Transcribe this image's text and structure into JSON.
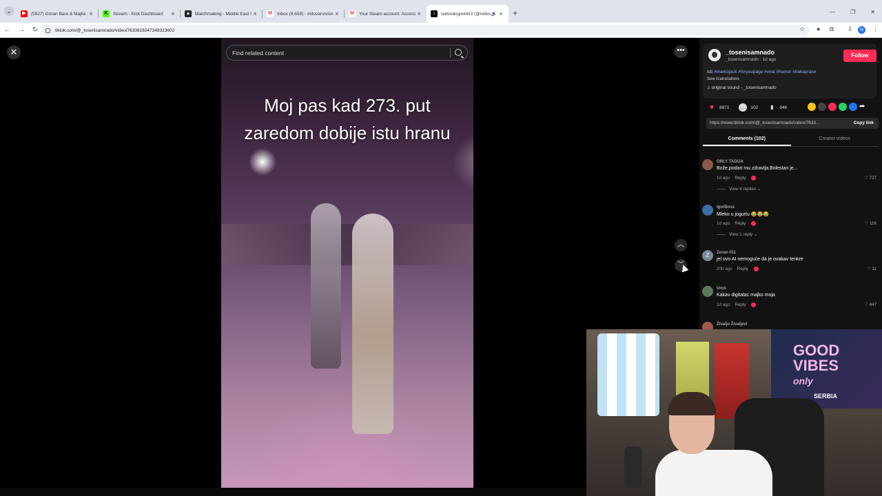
{
  "browser": {
    "tabs": [
      {
        "title": "(5927) Goran Bare & Majke - 3x",
        "favicon_color": "#ff0000",
        "active": false
      },
      {
        "title": "Stream - Kick Dashboard",
        "favicon_color": "#53fc18",
        "active": false
      },
      {
        "title": "Matchmaking - Middle East 5v5",
        "favicon_color": "#222222",
        "active": false
      },
      {
        "title": "Inbox (8,659) - milovanovicnem",
        "favicon_color": "#ea4335",
        "active": false
      },
      {
        "title": "Your Steam account: Access fro",
        "favicon_color": "#ea4335",
        "active": false
      },
      {
        "title": "redovangost4x3 (@redovan",
        "favicon_color": "#000000",
        "active": true
      }
    ],
    "url": "tiktok.com/@_tosenisamnado/video/7633828347348323602",
    "profile_initial": "N"
  },
  "player": {
    "search_placeholder": "Find related content",
    "caption_line1": "Moj pas kad  273. put",
    "caption_line2": "zaredom dobije istu hranu"
  },
  "post": {
    "username": "_tosenisamnado",
    "meta": "_tosenisamnado · 1d ago",
    "follow_label": "Follow",
    "desc_prefix": "Isti ",
    "hashtags": "#markojack #foryoupage #viral #humor #bakaprase",
    "see_translation": "See translation",
    "sound": "original sound - _tosenisamnado",
    "likes": "8871",
    "comments": "102",
    "saves": "946",
    "link": "https://www.tiktok.com/@_tosenisamnado/video/7633...",
    "copy_label": "Copy link"
  },
  "panel_tabs": {
    "comments": "Comments (102)",
    "creator": "Creator videos"
  },
  "comments": [
    {
      "name": "ONLY TADIJA",
      "text": "Bože,podari mu zdravlja.Bolestan je...",
      "time": "1d ago",
      "reply": "Reply",
      "likes": "727",
      "view_replies": "View 4 replies",
      "avatar_color": "#8a5a4a"
    },
    {
      "name": "IgorBoss",
      "text": "Mleko u jogurtu 😂😂😂",
      "time": "1d ago",
      "reply": "Reply",
      "likes": "116",
      "view_replies": "View 1 reply",
      "avatar_color": "#3b6ea5"
    },
    {
      "name": "Zoran 011",
      "text": "jel ovo AI nemoguće da je ovakav tenkre",
      "time": "20h ago",
      "reply": "Reply",
      "likes": "11",
      "avatar_letter": "Z",
      "avatar_color": "#7a8a9a"
    },
    {
      "name": "Uroš",
      "text": "Kakav digitalac majko moja",
      "time": "1d ago",
      "reply": "Reply",
      "likes": "447",
      "avatar_color": "#5a7a5a"
    },
    {
      "name": "Živaljo Živaljevi",
      "avatar_color": "#a05a4a"
    }
  ],
  "webcam_overlay": {
    "flag_text_line1": "GOOD",
    "flag_text_line2": "VIBES",
    "flag_text_line3": "only",
    "flag_banner": "SERBIA"
  }
}
